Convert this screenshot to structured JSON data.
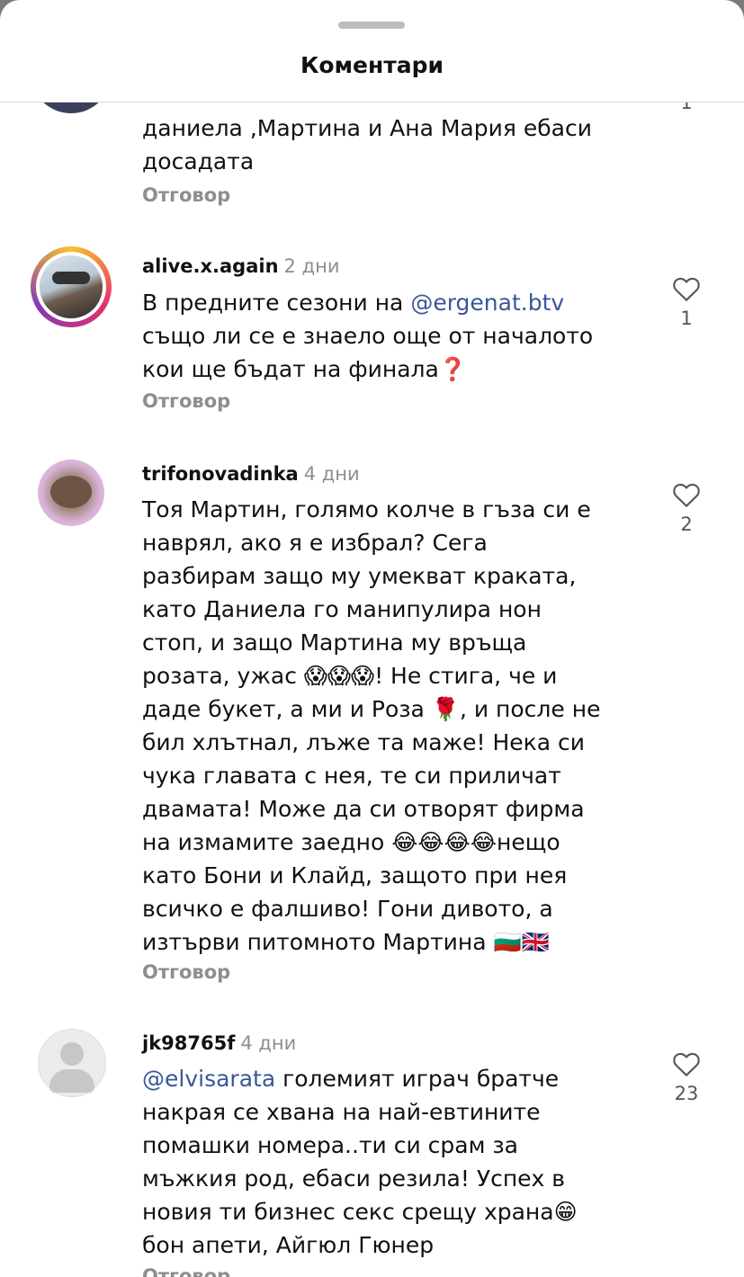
{
  "header": {
    "title": "Коментари"
  },
  "comments": [
    {
      "text": "даниела ,Мартина и Ана Мария ебаси досадата",
      "reply": "Отговор",
      "likes": "1"
    },
    {
      "username": "alive.x.again",
      "time": "2 дни",
      "mention": "@ergenat.btv",
      "text_before": "В предните сезони на ",
      "text_after": " също ли се е знаело още от началото кои ще бъдат на финала❓",
      "reply": "Отговор",
      "likes": "1"
    },
    {
      "username": "trifonovadinka",
      "time": "4 дни",
      "text": "Тоя Мартин, голямо колче в гъза си е наврял, ако я е избрал? Сега разбирам защо му умекват краката, като Даниела го манипулира нон стоп, и защо Мартина му връща розата, ужас 😱😱😱! Не стига, че и даде букет, а ми и Роза 🌹, и после не бил хлътнал, лъже та маже! Нека си чука главата с нея, те си приличат двамата! Може да си отворят фирма на измамите заедно 😂😂😂😂нещо като Бони и Клайд, защото при нея всичко е фалшиво! Гони дивото, а изтърви питомното Мартина 🇧🇬🇬🇧",
      "reply": "Отговор",
      "likes": "2"
    },
    {
      "username": "jk98765f",
      "time": "4 дни",
      "mention": "@elvisarata",
      "text_after": " големият играч братче накрая се хвана на най-евтините помашки номера..ти си срам за мъжкия род, ебаси резила! Успех в новия ти бизнес секс срещу храна😁 бон апети, Айгюл Гюнер",
      "reply": "Отговор",
      "likes": "23"
    }
  ]
}
